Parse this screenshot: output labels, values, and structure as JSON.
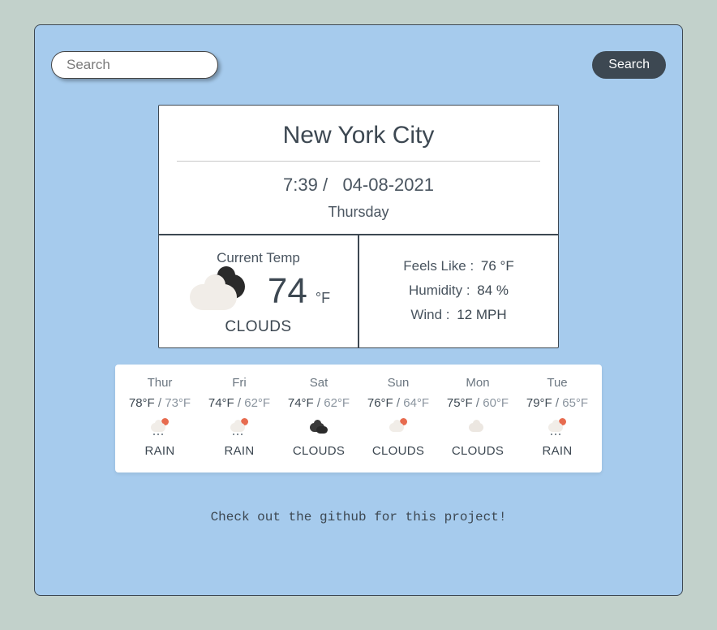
{
  "search": {
    "placeholder": "Search",
    "button_label": "Search"
  },
  "current": {
    "city": "New York City",
    "time": "7:39",
    "date": "04-08-2021",
    "day_name": "Thursday",
    "current_temp_label": "Current Temp",
    "temp_value": "74",
    "temp_unit": "°F",
    "condition": "CLOUDS",
    "feels_like_label": "Feels Like :",
    "feels_like_value": "76 °F",
    "humidity_label": "Humidity :",
    "humidity_value": "84 %",
    "wind_label": "Wind :",
    "wind_value": "12 MPH"
  },
  "forecast": [
    {
      "day": "Thur",
      "hi": "78°F",
      "lo": "73°F",
      "condition": "RAIN",
      "icon": "rain-sun"
    },
    {
      "day": "Fri",
      "hi": "74°F",
      "lo": "62°F",
      "condition": "RAIN",
      "icon": "rain-sun"
    },
    {
      "day": "Sat",
      "hi": "74°F",
      "lo": "62°F",
      "condition": "CLOUDS",
      "icon": "clouds-dark"
    },
    {
      "day": "Sun",
      "hi": "76°F",
      "lo": "64°F",
      "condition": "CLOUDS",
      "icon": "clouds-sun"
    },
    {
      "day": "Mon",
      "hi": "75°F",
      "lo": "60°F",
      "condition": "CLOUDS",
      "icon": "clouds-light"
    },
    {
      "day": "Tue",
      "hi": "79°F",
      "lo": "65°F",
      "condition": "RAIN",
      "icon": "rain-sun"
    }
  ],
  "footer": {
    "text": "Check out the github for this project!"
  }
}
